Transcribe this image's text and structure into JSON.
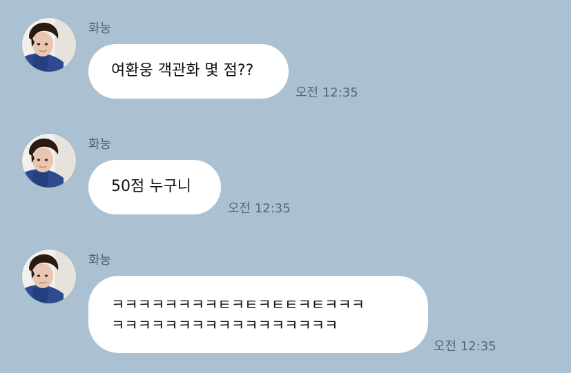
{
  "colors": {
    "background": "#abc1d1",
    "bubble": "#ffffff",
    "text": "#111111",
    "sender_text": "#545d66",
    "time_text": "#5b6670"
  },
  "messages": [
    {
      "sender": "화눙",
      "avatar_icon": "profile-photo",
      "lines": [
        "여환웅 객관화 몇 점??"
      ],
      "time": "오전 12:35"
    },
    {
      "sender": "화눙",
      "avatar_icon": "profile-photo",
      "lines": [
        "50점 누구니"
      ],
      "time": "오전 12:35"
    },
    {
      "sender": "화눙",
      "avatar_icon": "profile-photo",
      "lines": [
        "ㅋㅋㅋㅋㅋㅋㅋㅋㅌㅋㅌㅋㅌㅌㅋㅌㅋㅋㅋ",
        "ㅋㅋㅋㅋㅋㅋㅋㅋㅋㅋㅋㅋㅋㅋㅋㅋㅋ"
      ],
      "time": "오전 12:35"
    }
  ]
}
